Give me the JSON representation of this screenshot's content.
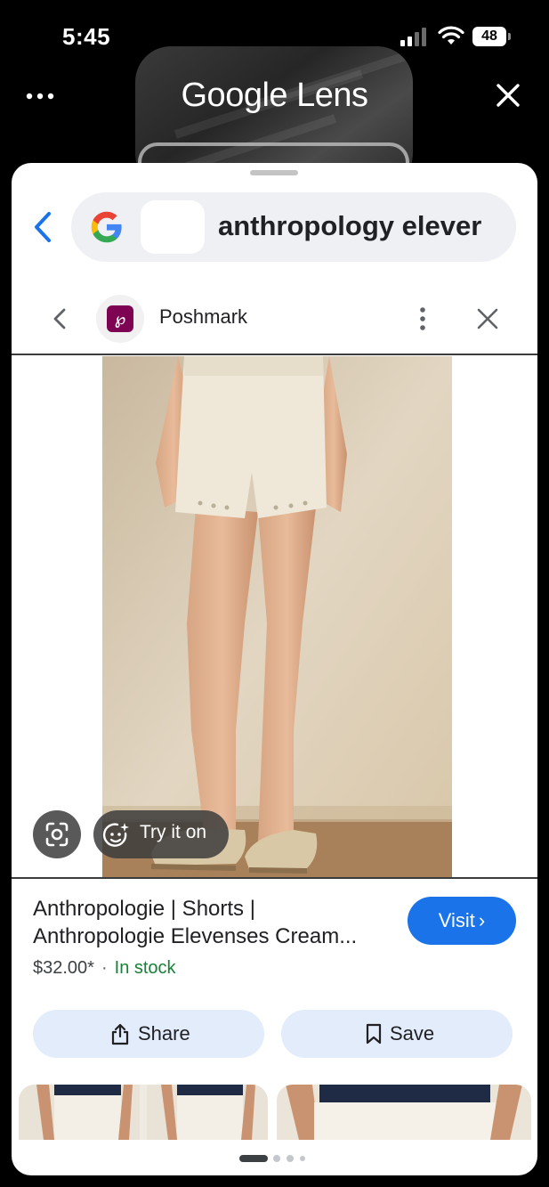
{
  "status_bar": {
    "time": "5:45",
    "battery": "48"
  },
  "header": {
    "title": "Google Lens"
  },
  "search": {
    "query": "anthropology elever"
  },
  "source": {
    "name": "Poshmark"
  },
  "photo_chips": {
    "try_on_label": "Try it on"
  },
  "product": {
    "title_line1": "Anthropologie | Shorts |",
    "title_line2": "Anthropologie Elevenses Cream...",
    "price": "$32.00*",
    "separator": "·",
    "availability": "In stock",
    "visit_label": "Visit"
  },
  "actions": {
    "share_label": "Share",
    "save_label": "Save"
  },
  "colors": {
    "accent": "#1a73e8",
    "stock": "#188038",
    "action_bg": "#e3ecfb",
    "poshmark": "#7f0353"
  },
  "icons": [
    "more-dots-icon",
    "close-icon",
    "back-arrow-icon",
    "google-logo-icon",
    "chevron-left-icon",
    "poshmark-logo-icon",
    "vertical-dots-icon",
    "lens-icon",
    "sparkle-face-icon",
    "share-icon",
    "bookmark-icon",
    "chevron-right-icon"
  ]
}
